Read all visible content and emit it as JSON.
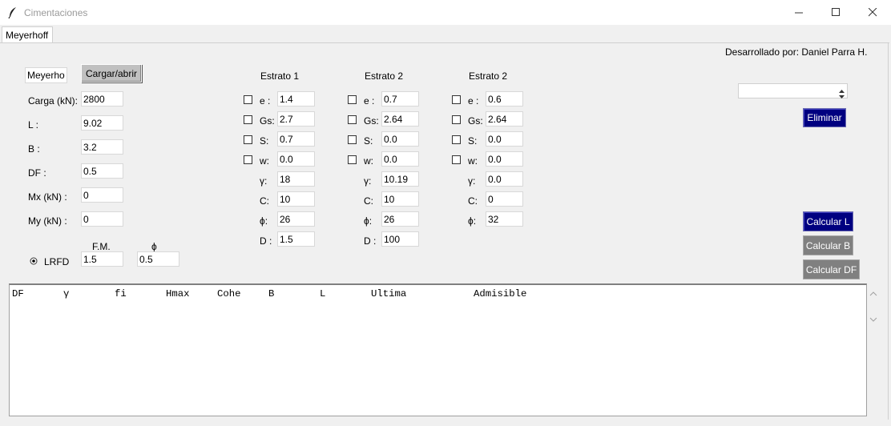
{
  "window": {
    "title": "Cimentaciones",
    "buttons": {
      "minimize": "—",
      "maximize": "☐",
      "close": "✕"
    }
  },
  "tab": {
    "label": "Meyerhoff"
  },
  "credit": "Desarrollado por: Daniel Parra H.",
  "method_field": {
    "value": "Meyerhoff"
  },
  "load_button": "Cargar/abrir",
  "params": [
    {
      "label": "Carga (kN):",
      "value": "2800"
    },
    {
      "label": "L :",
      "value": "9.02"
    },
    {
      "label": "B :",
      "value": "3.2"
    },
    {
      "label": "DF :",
      "value": "0.5"
    },
    {
      "label": "Mx (kN) :",
      "value": "0"
    },
    {
      "label": "My (kN) :",
      "value": "0"
    }
  ],
  "factors": {
    "fm_label": "F.M.",
    "phi_label": "ϕ",
    "lrfd_label": "LRFD",
    "fm_value": "1.5",
    "phi_value": "0.5"
  },
  "strata": [
    {
      "title": "Estrato 1",
      "rows": [
        {
          "label": "e :",
          "value": "1.4",
          "check": true
        },
        {
          "label": "Gs:",
          "value": "2.7",
          "check": true
        },
        {
          "label": "S:",
          "value": "0.7",
          "check": true
        },
        {
          "label": "w:",
          "value": "0.0",
          "check": true
        },
        {
          "label": "γ:",
          "value": "18",
          "check": false
        },
        {
          "label": "C:",
          "value": "10",
          "check": false
        },
        {
          "label": "ϕ:",
          "value": "26",
          "check": false
        },
        {
          "label": "D :",
          "value": "1.5",
          "check": false
        }
      ]
    },
    {
      "title": "Estrato 2",
      "rows": [
        {
          "label": "e :",
          "value": "0.7",
          "check": true
        },
        {
          "label": "Gs:",
          "value": "2.64",
          "check": true
        },
        {
          "label": "S:",
          "value": "0.0",
          "check": true
        },
        {
          "label": "w:",
          "value": "0.0",
          "check": true
        },
        {
          "label": "γ:",
          "value": "10.19",
          "check": false
        },
        {
          "label": "C:",
          "value": "10",
          "check": false
        },
        {
          "label": "ϕ:",
          "value": "26",
          "check": false
        },
        {
          "label": "D :",
          "value": "100",
          "check": false
        }
      ]
    },
    {
      "title": "Estrato 2",
      "rows": [
        {
          "label": "e :",
          "value": "0.6",
          "check": true
        },
        {
          "label": "Gs:",
          "value": "2.64",
          "check": true
        },
        {
          "label": "S:",
          "value": "0.0",
          "check": true
        },
        {
          "label": "w:",
          "value": "0.0",
          "check": true
        },
        {
          "label": "γ:",
          "value": "0.0",
          "check": false
        },
        {
          "label": "C:",
          "value": "0",
          "check": false
        },
        {
          "label": "ϕ:",
          "value": "32",
          "check": false
        }
      ]
    }
  ],
  "spinbox": {
    "value": ""
  },
  "buttons": {
    "eliminar": "Eliminar",
    "calcular_l": "Calcular L",
    "calcular_b": "Calcular B",
    "calcular_df": "Calcular DF"
  },
  "colors": {
    "primary_button": "#000080",
    "disabled_button": "#808080"
  },
  "output": {
    "headers": [
      "DF",
      "γ",
      "fi",
      "Hmax",
      "Cohe",
      "B",
      "L",
      "Ultima",
      "Admisible"
    ]
  }
}
